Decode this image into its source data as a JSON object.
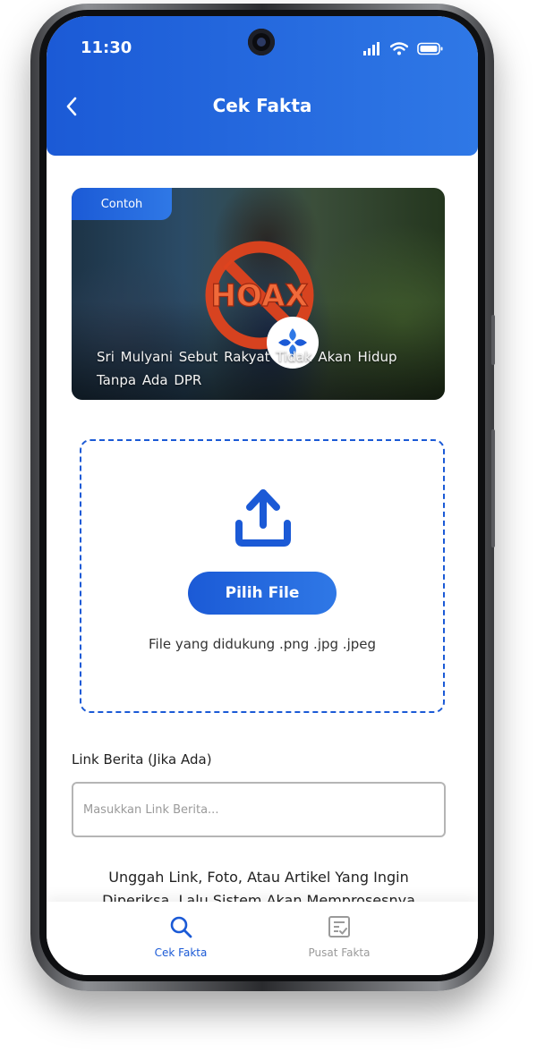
{
  "status_bar": {
    "time": "11:30"
  },
  "header": {
    "title": "Cek Fakta"
  },
  "example_card": {
    "tag": "Contoh",
    "hoax_stamp": "HOAX",
    "caption": "Sri Mulyani Sebut Rakyat Tidak Akan Hidup Tanpa Ada DPR"
  },
  "upload": {
    "button_label": "Pilih File",
    "supported_text": "File yang didukung .png .jpg .jpeg"
  },
  "link_field": {
    "label": "Link Berita (Jika Ada)",
    "placeholder": "Masukkan Link Berita...",
    "value": ""
  },
  "info_text": "Unggah Link, Foto, Atau Artikel Yang Ingin Diperiksa, Lalu Sistem Akan Memprosesnya Untukmu",
  "bottom_nav": {
    "items": [
      {
        "label": "Cek Fakta",
        "icon": "search-icon",
        "active": true
      },
      {
        "label": "Pusat Fakta",
        "icon": "checklist-icon",
        "active": false
      }
    ]
  },
  "colors": {
    "primary": "#1b5ad6",
    "primary_light": "#2f78e6",
    "hoax_red": "#e0431e"
  }
}
